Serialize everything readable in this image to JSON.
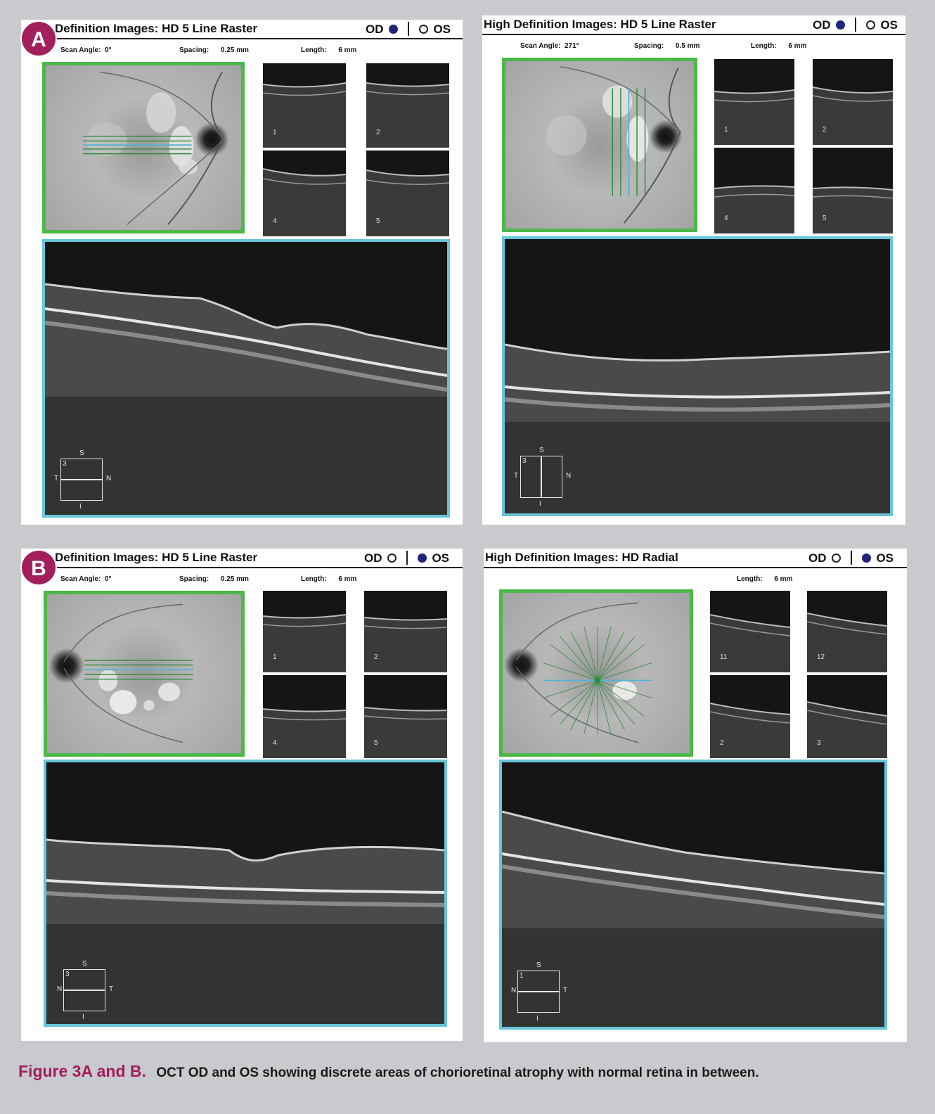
{
  "panels": [
    {
      "title": "Definition Images: HD 5 Line Raster",
      "od_label": "OD",
      "os_label": "OS",
      "selected_eye": "OD",
      "scan_angle_label": "Scan Angle:",
      "scan_angle": "0°",
      "spacing_label": "Spacing:",
      "spacing": "0.25 mm",
      "length_label": "Length:",
      "length": "6 mm",
      "thumbs": [
        "1",
        "2",
        "4",
        "5"
      ],
      "orientation": {
        "top": "S",
        "bottom": "I",
        "left": "T",
        "right": "N",
        "index": "3"
      }
    },
    {
      "title": "High Definition Images: HD 5 Line Raster",
      "od_label": "OD",
      "os_label": "OS",
      "selected_eye": "OD",
      "scan_angle_label": "Scan Angle:",
      "scan_angle": "271°",
      "spacing_label": "Spacing:",
      "spacing": "0.5 mm",
      "length_label": "Length:",
      "length": "6 mm",
      "thumbs": [
        "1",
        "2",
        "4",
        "5"
      ],
      "orientation": {
        "top": "S",
        "bottom": "I",
        "left": "T",
        "right": "N",
        "index": "3"
      }
    },
    {
      "title": "Definition Images: HD 5 Line Raster",
      "od_label": "OD",
      "os_label": "OS",
      "selected_eye": "OS",
      "scan_angle_label": "Scan Angle:",
      "scan_angle": "0°",
      "spacing_label": "Spacing:",
      "spacing": "0.25 mm",
      "length_label": "Length:",
      "length": "6 mm",
      "thumbs": [
        "1",
        "2",
        "4",
        "5"
      ],
      "orientation": {
        "top": "S",
        "bottom": "I",
        "left": "N",
        "right": "T",
        "index": "3"
      }
    },
    {
      "title": "High Definition Images:  HD Radial",
      "od_label": "OD",
      "os_label": "OS",
      "selected_eye": "OS",
      "length_label": "Length:",
      "length": "6 mm",
      "thumbs": [
        "11",
        "12",
        "2",
        "3"
      ],
      "orientation": {
        "top": "S",
        "bottom": "I",
        "left": "N",
        "right": "T",
        "index": "1"
      }
    }
  ],
  "badges": {
    "a": "A",
    "b": "B"
  },
  "caption": {
    "head": "Figure 3A and B.",
    "body": "OCT OD and OS showing discrete areas of chorioretinal atrophy with normal retina in between."
  },
  "colors": {
    "fundus_border": "#4cb848",
    "oct_border": "#67c4d9",
    "badge": "#a21e5d",
    "background": "#c8cacd"
  }
}
